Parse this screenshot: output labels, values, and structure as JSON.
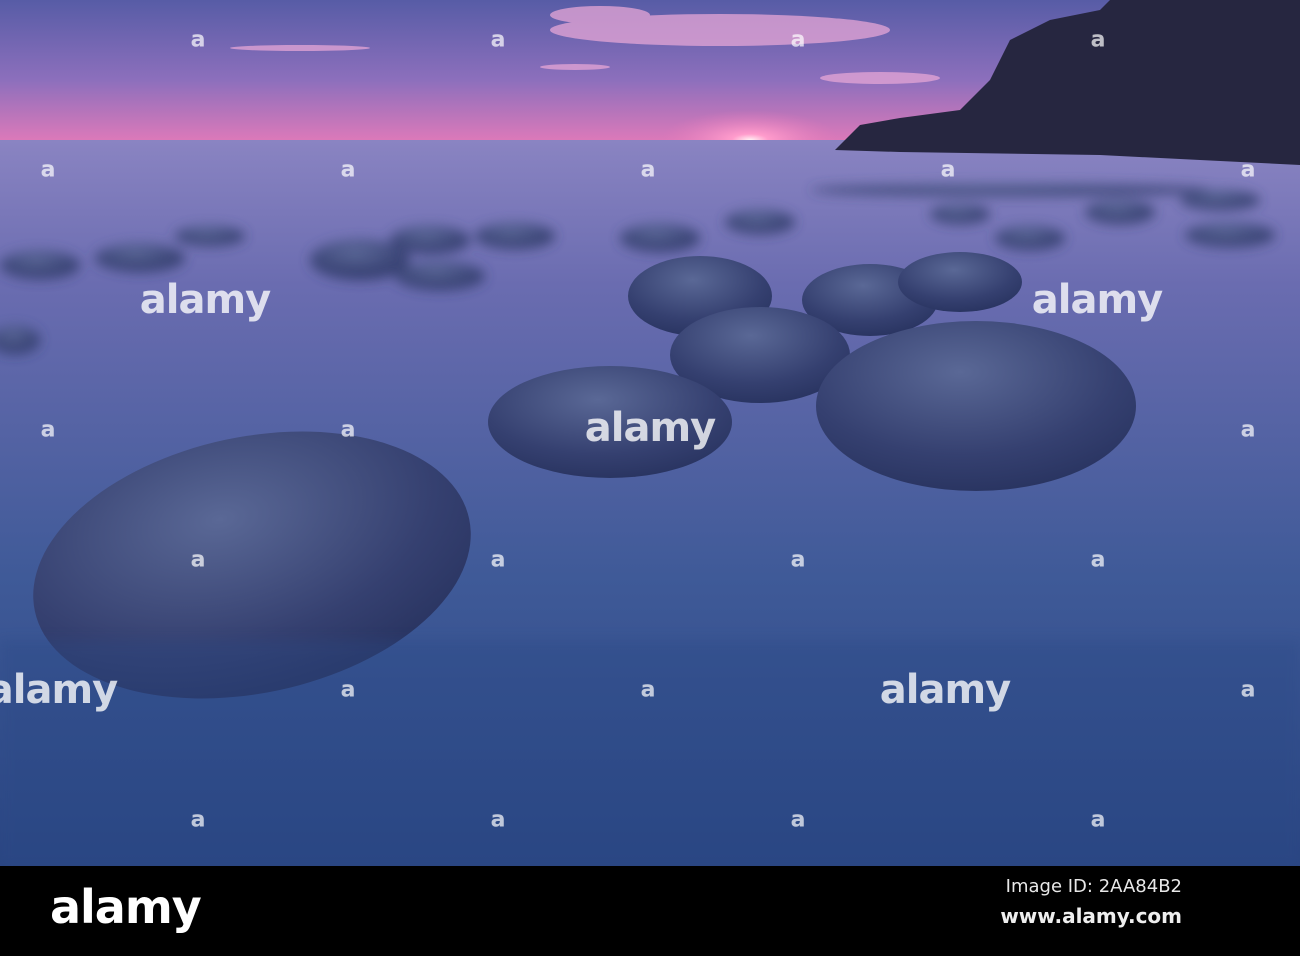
{
  "photo": {
    "colors": {
      "sky_top": "#5c5ea8",
      "horizon": "#e27ab9",
      "water_far": "#7b79b8",
      "water_near": "#2d4a86",
      "rock": "#3a4470",
      "cliff": "#262640"
    }
  },
  "watermark": {
    "text": "alamy",
    "mark": "a"
  },
  "footer": {
    "logo": "alamy",
    "image_id": "Image ID: 2AA84B2",
    "website": "www.alamy.com"
  }
}
